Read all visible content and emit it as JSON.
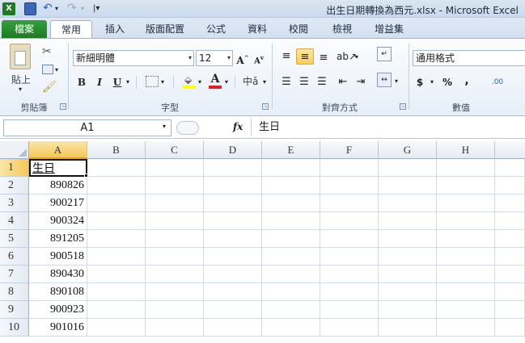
{
  "title": "出生日期轉換為西元.xlsx - Microsoft Excel",
  "quick_access": {
    "excel_icon": "excel-app-icon",
    "save_icon": "save-icon",
    "undo_icon": "undo-icon",
    "redo_icon": "redo-icon"
  },
  "tabs": [
    "檔案",
    "常用",
    "插入",
    "版面配置",
    "公式",
    "資料",
    "校閱",
    "檢視",
    "增益集"
  ],
  "ribbon": {
    "clipboard": {
      "paste": "貼上",
      "label": "剪貼簿"
    },
    "font": {
      "name": "新細明體",
      "size": "12",
      "bold": "B",
      "italic": "I",
      "underline": "U",
      "grow": "A",
      "shrink": "A",
      "color": "A",
      "label": "字型"
    },
    "alignment": {
      "label": "對齊方式"
    },
    "number": {
      "format": "通用格式",
      "currency": "$",
      "percent": "%",
      "comma": ",",
      "decimal": ".00",
      "label": "數值"
    }
  },
  "formula_bar": {
    "name_box": "A1",
    "fx": "fx",
    "content": "生日"
  },
  "sheet": {
    "columns": [
      "A",
      "B",
      "C",
      "D",
      "E",
      "F",
      "G",
      "H"
    ],
    "rows": [
      "1",
      "2",
      "3",
      "4",
      "5",
      "6",
      "7",
      "8",
      "9",
      "10"
    ],
    "colA": [
      "生日",
      "890826",
      "900217",
      "900324",
      "891205",
      "900518",
      "890430",
      "890108",
      "900923",
      "901016"
    ]
  }
}
